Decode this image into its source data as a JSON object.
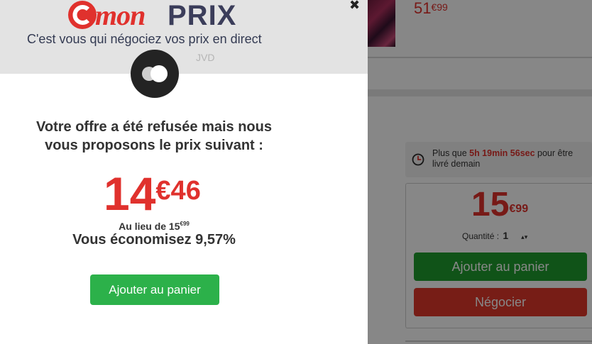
{
  "background": {
    "top_price": {
      "main": "51",
      "cents": "€99"
    },
    "delivery": {
      "prefix": "Plus que ",
      "countdown": "5h 19min 56sec",
      "suffix": " pour être livré demain"
    },
    "product_price": {
      "main": "15",
      "cents": "€99"
    },
    "quantity": {
      "label": "Quantité :",
      "value": "1",
      "arrows": "▴▾"
    },
    "add_to_cart_label": "Ajouter au panier",
    "negotiate_label": "Négocier"
  },
  "modal": {
    "logo": {
      "mon": "mon",
      "prix": "PRIX"
    },
    "tagline": "C'est vous qui négociez vos prix en direct",
    "close_glyph": "✖",
    "merchant": "JVD",
    "message_line1": "Votre offre a été refusée mais nous",
    "message_line2": "vous proposons le prix suivant :",
    "offer_price": {
      "main": "14",
      "cents": "€46"
    },
    "instead_of": {
      "label": "Au lieu de 15",
      "cents": "€99"
    },
    "savings": "Vous économisez 9,57%",
    "add_to_cart_label": "Ajouter au panier"
  },
  "colors": {
    "brand_red": "#e0312d",
    "brand_navy": "#3b3d5a",
    "add_green": "#2cb14a",
    "negotiate_red": "#e0372b"
  },
  "icons": [
    "c-logo-icon",
    "close-icon",
    "brand-circle-icon",
    "clock-icon",
    "quantity-arrows-icon"
  ]
}
